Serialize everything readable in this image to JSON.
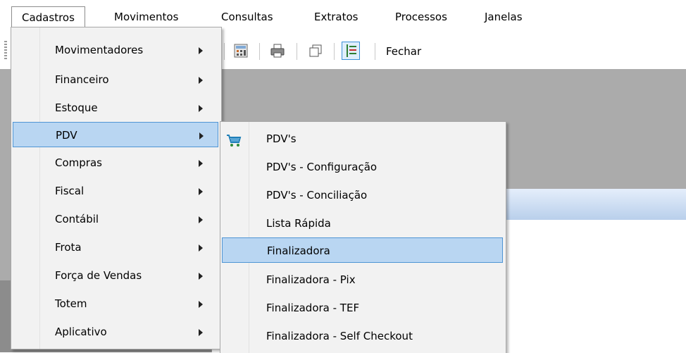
{
  "menubar": {
    "items": [
      {
        "label": "Cadastros"
      },
      {
        "label": "Movimentos"
      },
      {
        "label": "Consultas"
      },
      {
        "label": "Extratos"
      },
      {
        "label": "Processos"
      },
      {
        "label": "Janelas"
      }
    ]
  },
  "toolbar": {
    "close_label": "Fechar",
    "icons": [
      "calculator-icon",
      "printer-icon",
      "copy-window-icon",
      "list-toggle-icon"
    ]
  },
  "cadastros_menu": {
    "items": [
      {
        "label": "Movimentadores"
      },
      {
        "label": "Financeiro"
      },
      {
        "label": "Estoque"
      },
      {
        "label": "PDV"
      },
      {
        "label": "Compras"
      },
      {
        "label": "Fiscal"
      },
      {
        "label": "Contábil"
      },
      {
        "label": "Frota"
      },
      {
        "label": "Força de Vendas"
      },
      {
        "label": "Totem"
      },
      {
        "label": "Aplicativo"
      }
    ],
    "highlighted": "PDV"
  },
  "pdv_submenu": {
    "items": [
      {
        "label": "PDV's",
        "icon": "shopping-cart-icon"
      },
      {
        "label": "PDV's - Configuração"
      },
      {
        "label": "PDV's - Conciliação"
      },
      {
        "label": "Lista Rápida"
      },
      {
        "label": "Finalizadora"
      },
      {
        "label": "Finalizadora - Pix"
      },
      {
        "label": "Finalizadora - TEF"
      },
      {
        "label": "Finalizadora - Self Checkout"
      }
    ],
    "highlighted": "Finalizadora"
  },
  "colors": {
    "highlight_bg": "#b9d6f2",
    "highlight_border": "#4f95d4",
    "menu_bg": "#f2f2f2",
    "workspace_bg": "#ababab"
  }
}
